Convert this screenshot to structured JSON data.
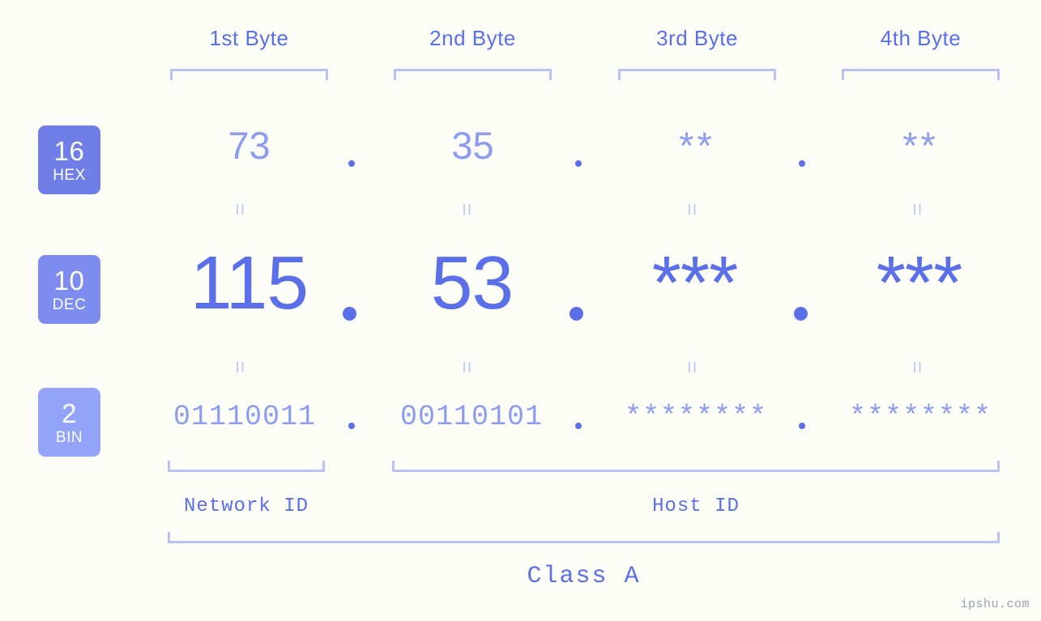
{
  "watermark": "ipshu.com",
  "colors": {
    "background": "#fbfdf6",
    "accent_strong": "#5b6fe8",
    "accent_light": "#8d9bf0",
    "bracket": "#b9c2f5",
    "badge_hex": "#707ee8",
    "badge_dec": "#7f8cef",
    "badge_bin": "#93a3f7"
  },
  "headers": [
    {
      "label": "1st Byte"
    },
    {
      "label": "2nd Byte"
    },
    {
      "label": "3rd Byte"
    },
    {
      "label": "4th Byte"
    }
  ],
  "bases": [
    {
      "number": "16",
      "name": "HEX"
    },
    {
      "number": "10",
      "name": "DEC"
    },
    {
      "number": "2",
      "name": "BIN"
    }
  ],
  "rows": {
    "hex": {
      "base": "16",
      "name": "HEX",
      "values": [
        "73",
        "35",
        "**",
        "**"
      ]
    },
    "dec": {
      "base": "10",
      "name": "DEC",
      "values": [
        "115",
        "53",
        "***",
        "***"
      ]
    },
    "bin": {
      "base": "2",
      "name": "BIN",
      "values": [
        "01110011",
        "00110101",
        "********",
        "********"
      ]
    }
  },
  "separators": {
    "dot": ".",
    "equals": "="
  },
  "sections": {
    "network_id": "Network ID",
    "host_id": "Host ID",
    "class": "Class A"
  }
}
